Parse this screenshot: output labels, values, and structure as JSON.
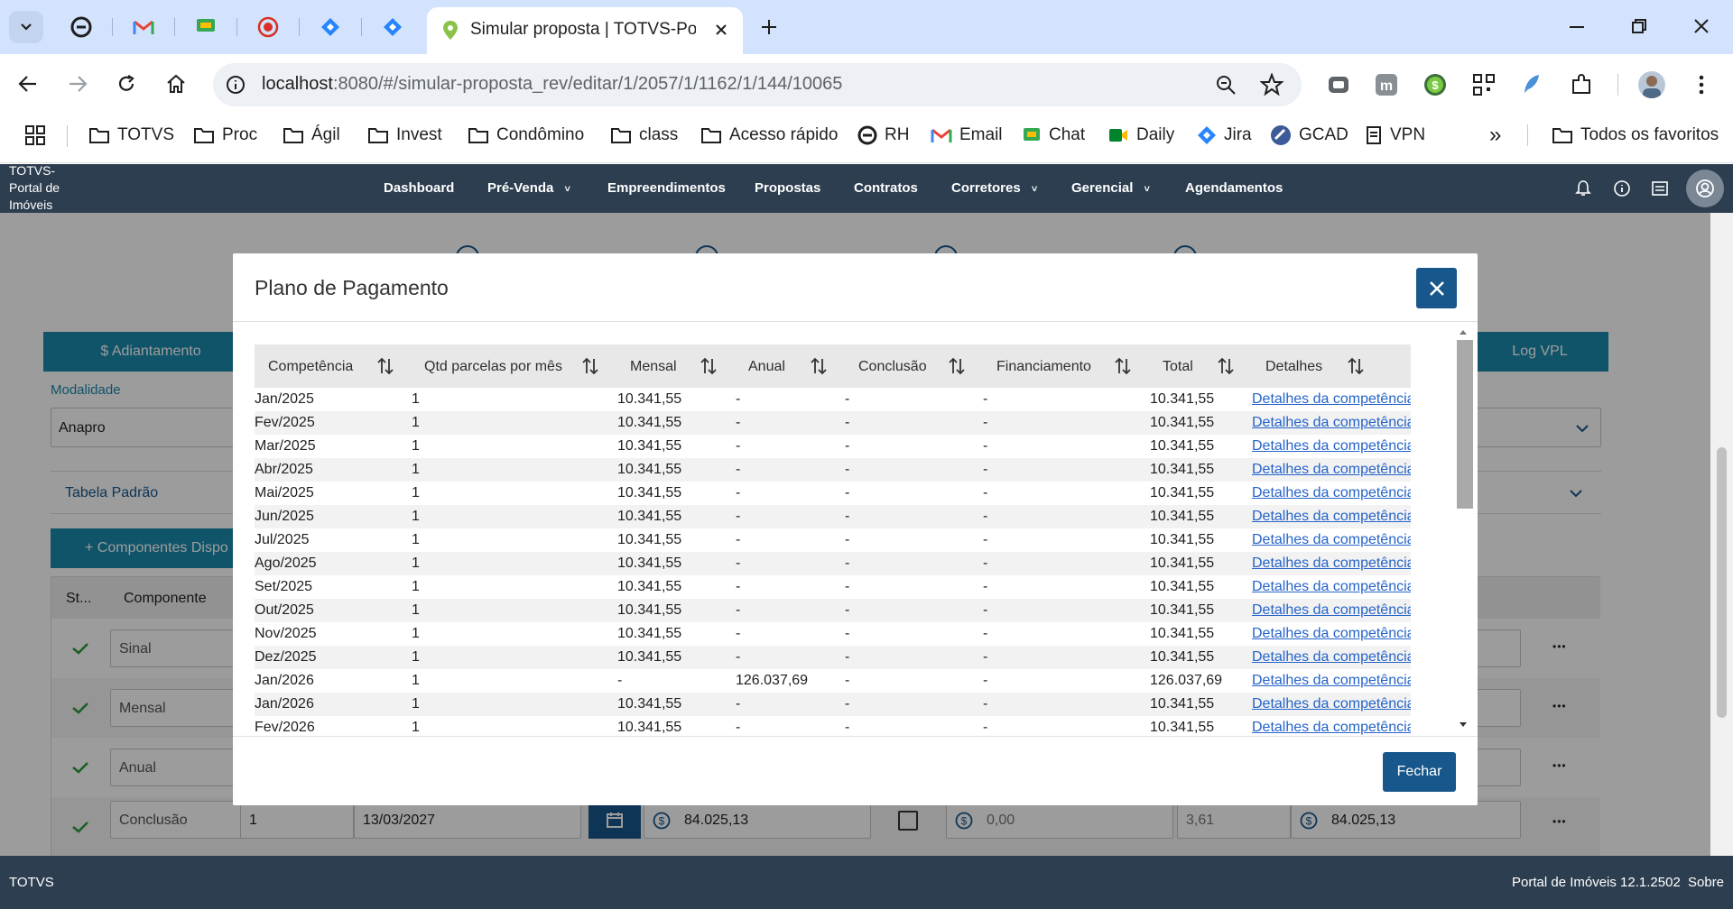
{
  "browser": {
    "active_tab_title": "Simular proposta | TOTVS-Portal de Imóveis",
    "url_host": "localhost",
    "url_rest": ":8080/#/simular-proposta_rev/editar/1/2057/1/1162/1/144/10065",
    "bookmarks": [
      "TOTVS",
      "Proc",
      "Ágil",
      "Invest",
      "Condômino",
      "class",
      "Acesso rápido",
      "RH",
      "Email",
      "Chat",
      "Daily",
      "Jira",
      "GCAD",
      "VPN"
    ],
    "all_bookmarks": "Todos os favoritos",
    "more": "»"
  },
  "app": {
    "logo_lines": [
      "TOTVS-",
      "Portal de",
      "Imóveis"
    ],
    "nav": [
      "Dashboard",
      "Pré-Venda",
      "Empreendimentos",
      "Propostas",
      "Contratos",
      "Corretores",
      "Gerencial",
      "Agendamentos"
    ],
    "dropdown_marker": "˅"
  },
  "background": {
    "adiantamento": "$ Adiantamento",
    "log_vpl": "Log VPL",
    "modalidade_label": "Modalidade",
    "modalidade_value": "Anapro",
    "tabela": "Tabela Padrão",
    "componentes_btn": "+ Componentes Dispo",
    "col_st": "St...",
    "col_componente": "Componente",
    "components": [
      "Sinal",
      "Mensal",
      "Anual",
      "Conclusão"
    ],
    "conclusao_row": {
      "qtd": "1",
      "date": "13/03/2027",
      "valor": "84.025,13",
      "fin": "0,00",
      "rate": "3,61",
      "total": "84.025,13"
    },
    "more_dots": "•••"
  },
  "modal": {
    "title": "Plano de Pagamento",
    "close_label": "Fechar",
    "close_x": "✕",
    "columns": [
      "Competência",
      "Qtd parcelas por mês",
      "Mensal",
      "Anual",
      "Conclusão",
      "Financiamento",
      "Total",
      "Detalhes"
    ],
    "rows": [
      [
        "Jan/2025",
        "1",
        "10.341,55",
        "-",
        "-",
        "-",
        "10.341,55",
        "Detalhes da competência"
      ],
      [
        "Fev/2025",
        "1",
        "10.341,55",
        "-",
        "-",
        "-",
        "10.341,55",
        "Detalhes da competência"
      ],
      [
        "Mar/2025",
        "1",
        "10.341,55",
        "-",
        "-",
        "-",
        "10.341,55",
        "Detalhes da competência"
      ],
      [
        "Abr/2025",
        "1",
        "10.341,55",
        "-",
        "-",
        "-",
        "10.341,55",
        "Detalhes da competência"
      ],
      [
        "Mai/2025",
        "1",
        "10.341,55",
        "-",
        "-",
        "-",
        "10.341,55",
        "Detalhes da competência"
      ],
      [
        "Jun/2025",
        "1",
        "10.341,55",
        "-",
        "-",
        "-",
        "10.341,55",
        "Detalhes da competência"
      ],
      [
        "Jul/2025",
        "1",
        "10.341,55",
        "-",
        "-",
        "-",
        "10.341,55",
        "Detalhes da competência"
      ],
      [
        "Ago/2025",
        "1",
        "10.341,55",
        "-",
        "-",
        "-",
        "10.341,55",
        "Detalhes da competência"
      ],
      [
        "Set/2025",
        "1",
        "10.341,55",
        "-",
        "-",
        "-",
        "10.341,55",
        "Detalhes da competência"
      ],
      [
        "Out/2025",
        "1",
        "10.341,55",
        "-",
        "-",
        "-",
        "10.341,55",
        "Detalhes da competência"
      ],
      [
        "Nov/2025",
        "1",
        "10.341,55",
        "-",
        "-",
        "-",
        "10.341,55",
        "Detalhes da competência"
      ],
      [
        "Dez/2025",
        "1",
        "10.341,55",
        "-",
        "-",
        "-",
        "10.341,55",
        "Detalhes da competência"
      ],
      [
        "Jan/2026",
        "1",
        "-",
        "126.037,69",
        "-",
        "-",
        "126.037,69",
        "Detalhes da competência"
      ],
      [
        "Jan/2026",
        "1",
        "10.341,55",
        "-",
        "-",
        "-",
        "10.341,55",
        "Detalhes da competência"
      ],
      [
        "Fev/2026",
        "1",
        "10.341,55",
        "-",
        "-",
        "-",
        "10.341,55",
        "Detalhes da competência"
      ]
    ]
  },
  "footer": {
    "left": "TOTVS",
    "right": "Portal de Imóveis 12.1.2502",
    "about": "Sobre"
  },
  "colors": {
    "nav_bg": "#2d3e50",
    "accent_blue": "#17578b",
    "teal_button": "#1b89ad",
    "link": "#2563c9",
    "check_green": "#2e9b3a"
  }
}
